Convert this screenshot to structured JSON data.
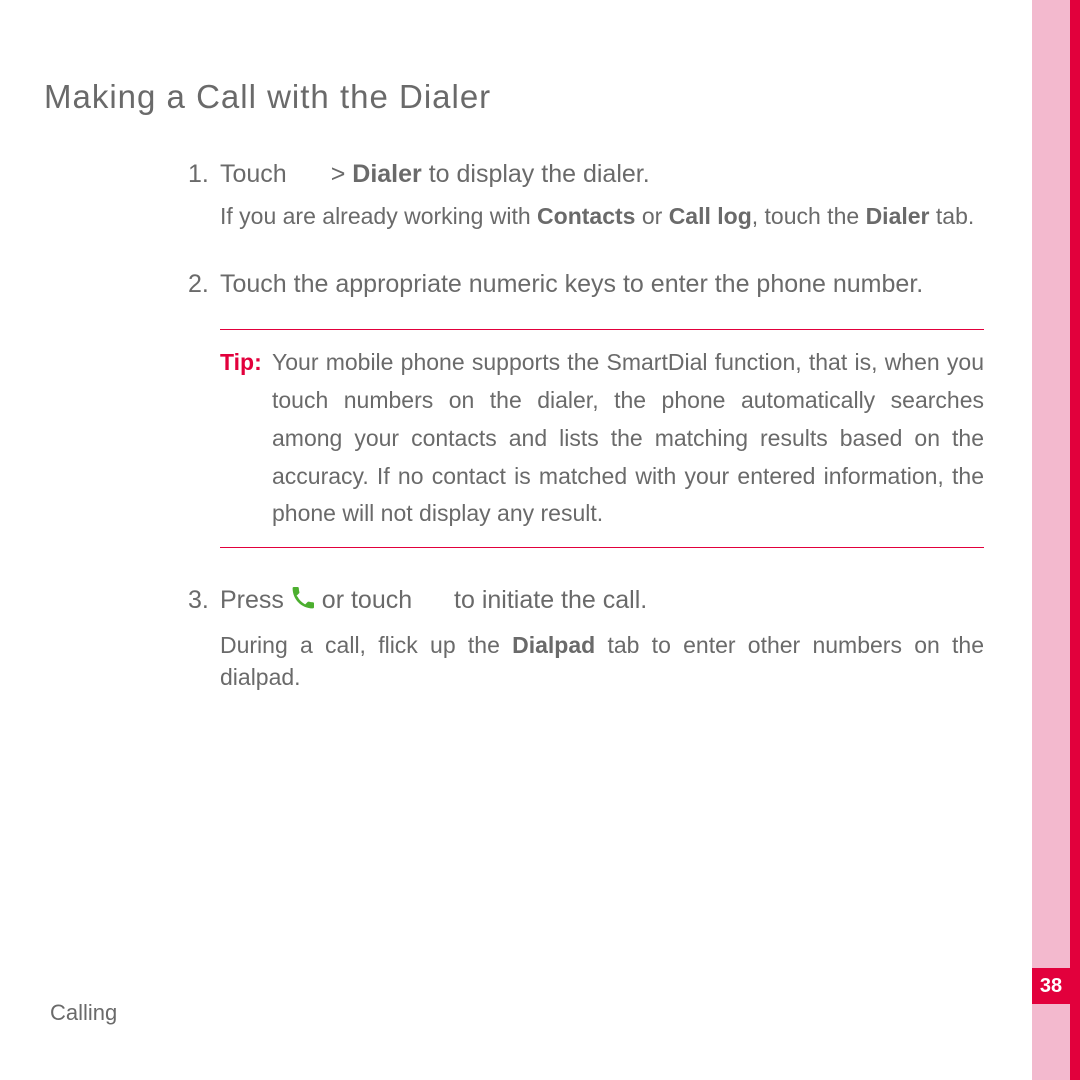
{
  "title": "Making a Call with the Dialer",
  "steps": {
    "s1": {
      "part1": "Touch",
      "part2": "> ",
      "bold1": "Dialer",
      "part3": " to display the dialer.",
      "sub_a": "If you are already working with ",
      "sub_b": "Contacts",
      "sub_c": " or ",
      "sub_d": "Call log",
      "sub_e": ", touch the ",
      "sub_f": "Dialer",
      "sub_g": " tab."
    },
    "s2": {
      "main": "Touch the appropriate numeric keys to enter the phone number.",
      "tip_label": "Tip: ",
      "tip_body": "Your mobile phone supports the SmartDial function, that is, when you touch numbers on the dialer, the phone automatically searches among your contacts and lists the matching results based on the accuracy. If no contact is matched with your entered information, the phone will not display any result."
    },
    "s3": {
      "part1": "Press ",
      "part2": " or touch ",
      "part3": " to initiate the call.",
      "sub_a": "During a call, flick up the ",
      "sub_b": "Dialpad",
      "sub_c": " tab to enter other numbers on the dialpad."
    }
  },
  "footer": "Calling",
  "page_number": "38"
}
